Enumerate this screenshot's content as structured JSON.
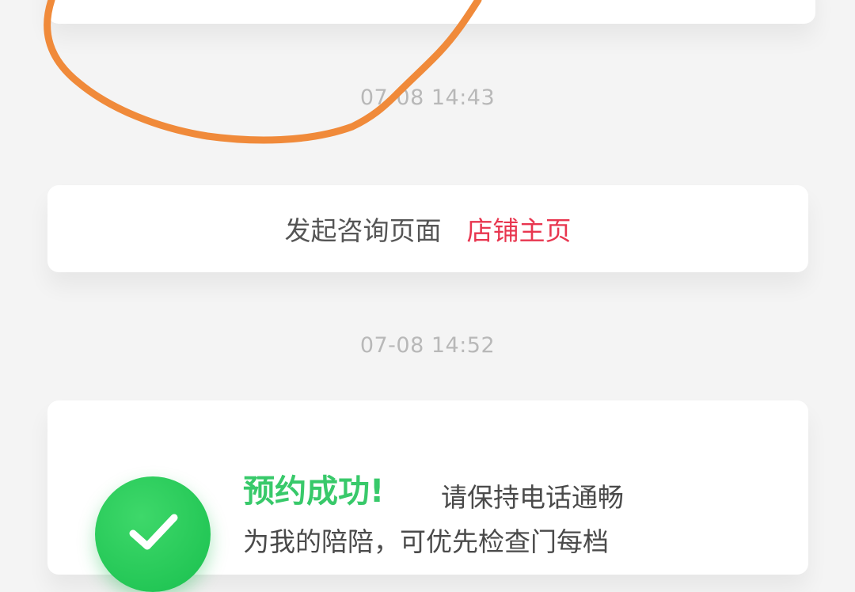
{
  "messages": [
    {
      "timestamp": "07-08 14:43"
    },
    {
      "timestamp": "07-08 14:52"
    }
  ],
  "consult_card": {
    "text": "发起咨询页面",
    "link_label": "店铺主页"
  },
  "booking_card": {
    "title": "预约成功!",
    "subtitle": "请保持电话通畅",
    "line2": "为我的陪陪，可优先检查门每档"
  },
  "icons": {
    "check": "check-icon"
  },
  "colors": {
    "background": "#f4f4f4",
    "card": "#ffffff",
    "timestamp": "#b8b8b8",
    "link": "#e8364f",
    "success": "#38c96a",
    "annotation": "#f08a3a"
  }
}
